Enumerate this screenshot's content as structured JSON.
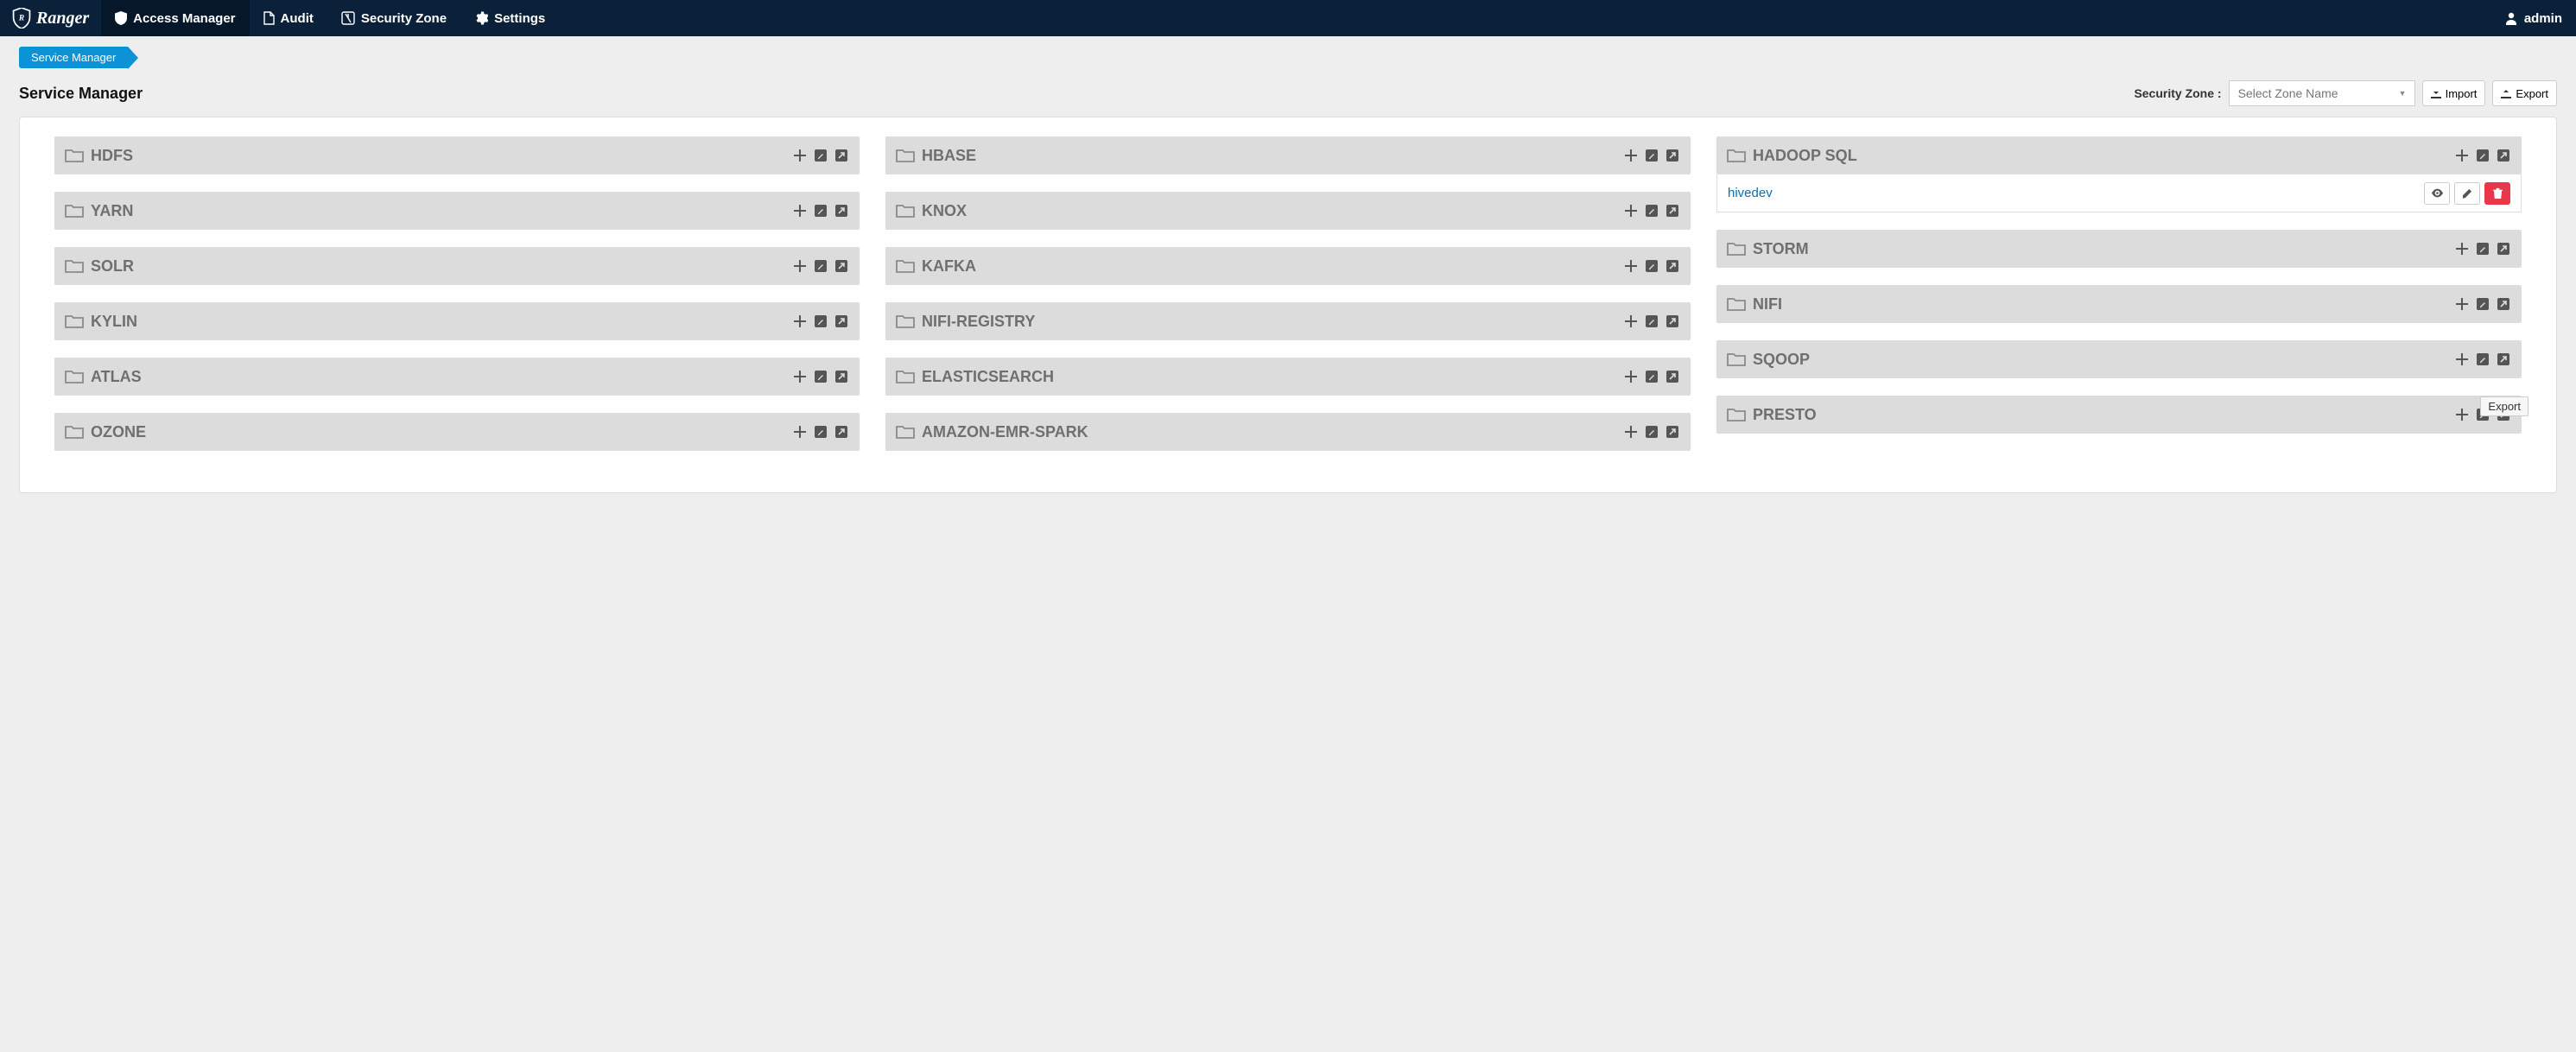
{
  "nav": {
    "brand": "Ranger",
    "items": [
      {
        "label": "Access Manager"
      },
      {
        "label": "Audit"
      },
      {
        "label": "Security Zone"
      },
      {
        "label": "Settings"
      }
    ],
    "user": "admin"
  },
  "breadcrumb": {
    "label": "Service Manager"
  },
  "page": {
    "title": "Service Manager",
    "zone_label": "Security Zone :",
    "zone_placeholder": "Select Zone Name",
    "import_label": "Import",
    "export_label": "Export"
  },
  "columns": [
    [
      {
        "name": "HDFS",
        "instances": []
      },
      {
        "name": "YARN",
        "instances": []
      },
      {
        "name": "SOLR",
        "instances": []
      },
      {
        "name": "KYLIN",
        "instances": []
      },
      {
        "name": "ATLAS",
        "instances": []
      },
      {
        "name": "OZONE",
        "instances": []
      }
    ],
    [
      {
        "name": "HBASE",
        "instances": []
      },
      {
        "name": "KNOX",
        "instances": []
      },
      {
        "name": "KAFKA",
        "instances": []
      },
      {
        "name": "NIFI-REGISTRY",
        "instances": []
      },
      {
        "name": "ELASTICSEARCH",
        "instances": []
      },
      {
        "name": "AMAZON-EMR-SPARK",
        "instances": []
      }
    ],
    [
      {
        "name": "HADOOP SQL",
        "instances": [
          {
            "name": "hivedev"
          }
        ]
      },
      {
        "name": "STORM",
        "instances": []
      },
      {
        "name": "NIFI",
        "instances": []
      },
      {
        "name": "SQOOP",
        "instances": []
      },
      {
        "name": "PRESTO",
        "instances": []
      }
    ]
  ],
  "tooltip": "Export"
}
